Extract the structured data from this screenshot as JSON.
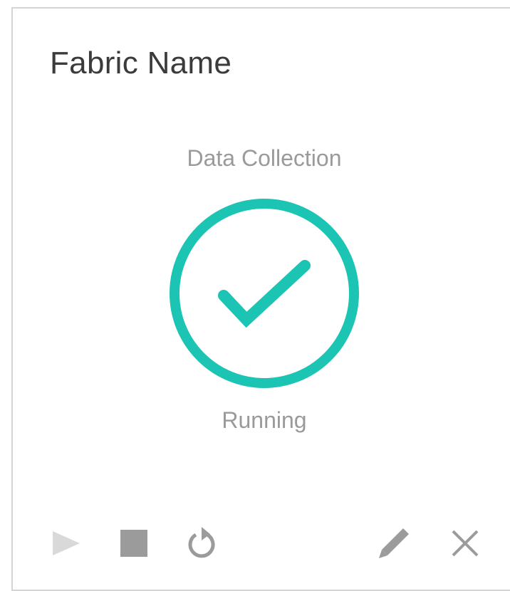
{
  "card": {
    "title": "Fabric Name",
    "section_label": "Data Collection",
    "status_text": "Running",
    "status_icon": "check-circle-icon",
    "accent_color": "#1cc4b3"
  },
  "toolbar": {
    "actions": [
      {
        "name": "play",
        "icon": "play-icon",
        "enabled": false
      },
      {
        "name": "stop",
        "icon": "stop-icon",
        "enabled": true
      },
      {
        "name": "restart",
        "icon": "refresh-icon",
        "enabled": true
      },
      {
        "name": "edit",
        "icon": "pencil-icon",
        "enabled": true
      },
      {
        "name": "delete",
        "icon": "close-icon",
        "enabled": true
      }
    ],
    "enabled_color": "#9b9b9b",
    "disabled_color": "#d9d9d9"
  }
}
